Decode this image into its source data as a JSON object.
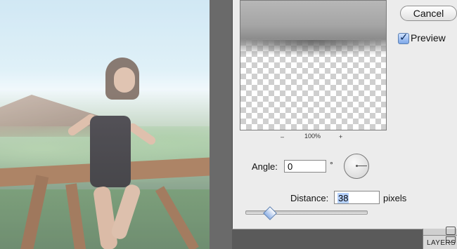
{
  "dialog": {
    "cancel_label": "Cancel",
    "preview_label": "Preview",
    "preview_checked": true,
    "zoom": {
      "minus": "–",
      "value": "100%",
      "plus": "+"
    },
    "angle": {
      "label": "Angle:",
      "value": "0",
      "unit": "°"
    },
    "distance": {
      "label": "Distance:",
      "value": "38",
      "unit": "pixels",
      "slider_fraction": 0.2
    }
  },
  "panel": {
    "layers_label": "LAYERS"
  },
  "icons": {
    "checkmark": "check-icon",
    "angle_dial": "angle-dial-icon"
  },
  "colors": {
    "dialog_bg": "#ececec",
    "accent": "#5b7fb1",
    "selection": "#b7d3ff"
  }
}
